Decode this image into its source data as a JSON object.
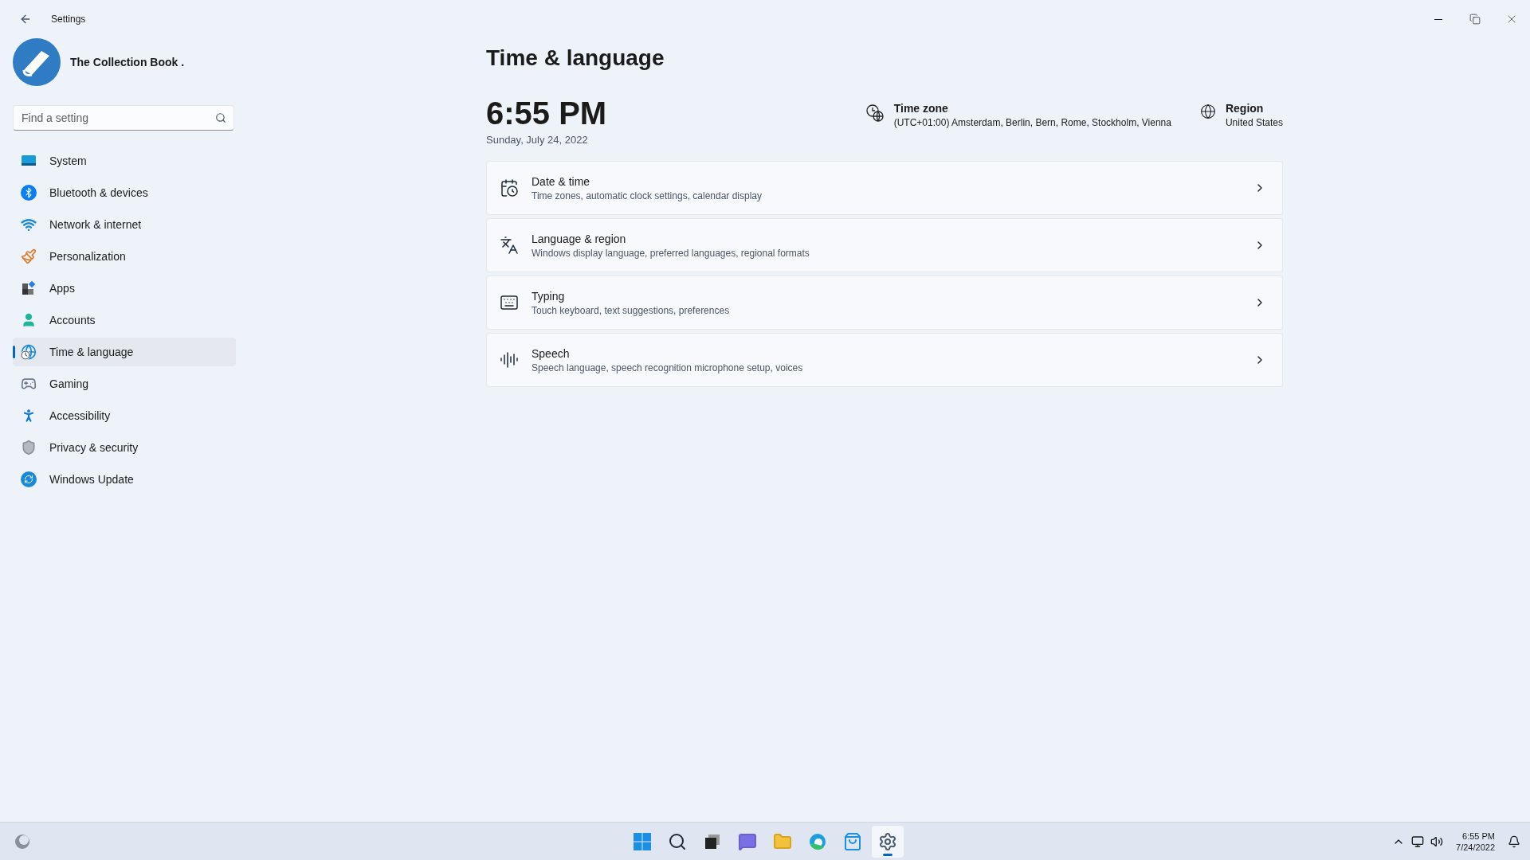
{
  "window": {
    "title": "Settings"
  },
  "account": {
    "name": "The Collection Book ."
  },
  "search": {
    "placeholder": "Find a setting"
  },
  "sidebar": {
    "items": [
      {
        "label": "System",
        "kind": "system",
        "selected": false
      },
      {
        "label": "Bluetooth & devices",
        "kind": "bluetooth",
        "selected": false
      },
      {
        "label": "Network & internet",
        "kind": "network",
        "selected": false
      },
      {
        "label": "Personalization",
        "kind": "brush",
        "selected": false
      },
      {
        "label": "Apps",
        "kind": "apps",
        "selected": false
      },
      {
        "label": "Accounts",
        "kind": "accounts",
        "selected": false
      },
      {
        "label": "Time & language",
        "kind": "time",
        "selected": true
      },
      {
        "label": "Gaming",
        "kind": "gaming",
        "selected": false
      },
      {
        "label": "Accessibility",
        "kind": "accessibility",
        "selected": false
      },
      {
        "label": "Privacy & security",
        "kind": "shield",
        "selected": false
      },
      {
        "label": "Windows Update",
        "kind": "update",
        "selected": false
      }
    ]
  },
  "page": {
    "title": "Time & language",
    "time": "6:55 PM",
    "date": "Sunday, July 24, 2022",
    "time_zone": {
      "label": "Time zone",
      "value": "(UTC+01:00) Amsterdam, Berlin, Bern, Rome, Stockholm, Vienna"
    },
    "region": {
      "label": "Region",
      "value": "United States"
    }
  },
  "cards": [
    {
      "kind": "datetime",
      "title": "Date & time",
      "subtitle": "Time zones, automatic clock settings, calendar display"
    },
    {
      "kind": "language",
      "title": "Language & region",
      "subtitle": "Windows display language, preferred languages, regional formats"
    },
    {
      "kind": "typing",
      "title": "Typing",
      "subtitle": "Touch keyboard, text suggestions, preferences"
    },
    {
      "kind": "speech",
      "title": "Speech",
      "subtitle": "Speech language, speech recognition microphone setup, voices"
    }
  ],
  "taskbar": {
    "apps": [
      {
        "kind": "start",
        "selected": false
      },
      {
        "kind": "search",
        "selected": false
      },
      {
        "kind": "taskview",
        "selected": false
      },
      {
        "kind": "chat",
        "selected": false
      },
      {
        "kind": "folder",
        "selected": false
      },
      {
        "kind": "edge",
        "selected": false
      },
      {
        "kind": "store",
        "selected": false
      },
      {
        "kind": "settings",
        "selected": true
      }
    ],
    "time": "6:55 PM",
    "date": "7/24/2022"
  }
}
